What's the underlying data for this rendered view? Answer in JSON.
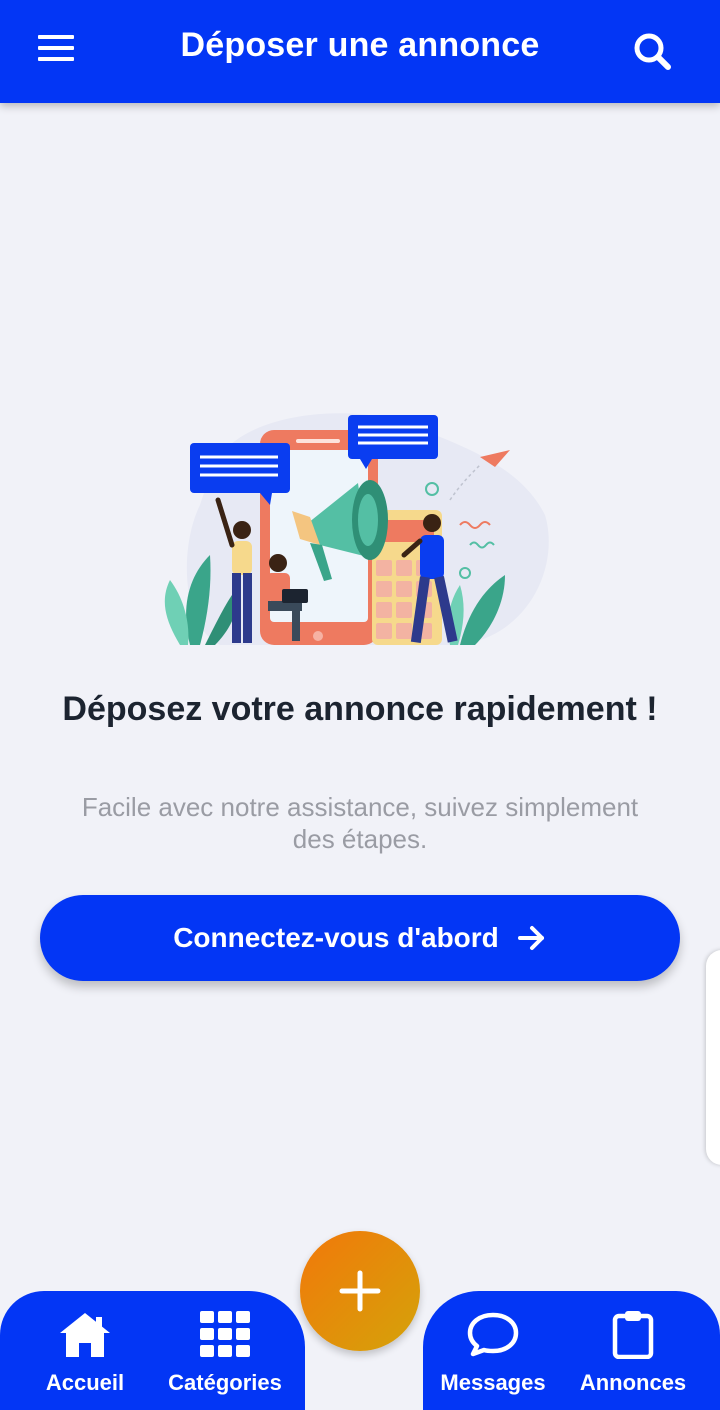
{
  "header": {
    "title": "Déposer une annonce",
    "menu_icon": "menu-icon",
    "search_icon": "search-icon"
  },
  "main": {
    "headline": "Déposez votre annonce rapidement !",
    "subtitle": "Facile avec notre assistance, suivez simplement des étapes.",
    "cta_label": "Connectez-vous d'abord",
    "cta_icon": "arrow-right-icon",
    "illustration": "megaphone-announcement-illustration"
  },
  "bottom_nav": {
    "items": [
      {
        "label": "Accueil",
        "icon": "home-icon"
      },
      {
        "label": "Catégories",
        "icon": "grid-icon"
      },
      {
        "label": "Messages",
        "icon": "chat-bubble-icon"
      },
      {
        "label": "Annonces",
        "icon": "clipboard-icon"
      }
    ],
    "fab_icon": "plus-icon"
  },
  "colors": {
    "primary": "#0336f5",
    "fab_start": "#f2780a",
    "fab_end": "#d4a30a",
    "background": "#f1f2f8",
    "text_dark": "#1c2430",
    "text_muted": "#9a9ca4"
  }
}
